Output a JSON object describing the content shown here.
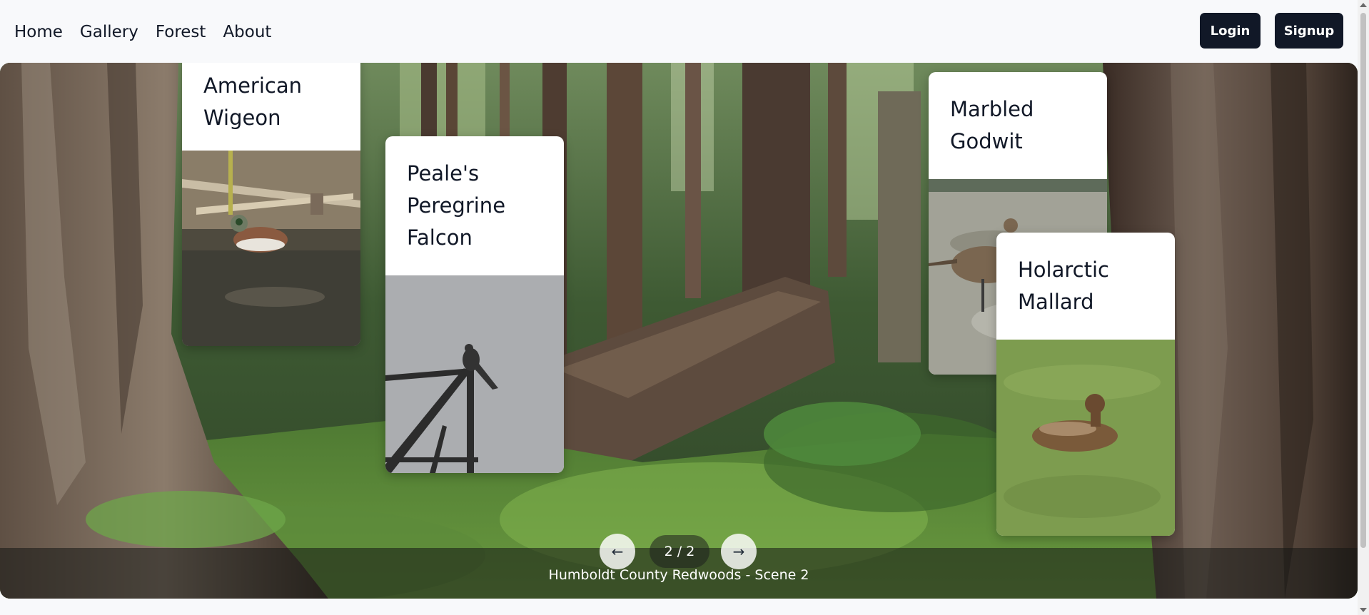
{
  "nav": {
    "links": [
      "Home",
      "Gallery",
      "Forest",
      "About"
    ],
    "login_label": "Login",
    "signup_label": "Signup"
  },
  "scene": {
    "caption": "Humboldt County Redwoods - Scene 2",
    "page_indicator": "2 / 2",
    "prev_icon": "←",
    "next_icon": "→"
  },
  "cards": {
    "wigeon": {
      "title": "American Wigeon"
    },
    "falcon": {
      "title": "Peale's Peregrine Falcon"
    },
    "godwit": {
      "title": "Marbled Godwit"
    },
    "mallard": {
      "title": "Holarctic Mallard"
    }
  },
  "colors": {
    "nav_bg": "#f8f9fb",
    "button_bg": "#111827",
    "button_text": "#ffffff"
  }
}
